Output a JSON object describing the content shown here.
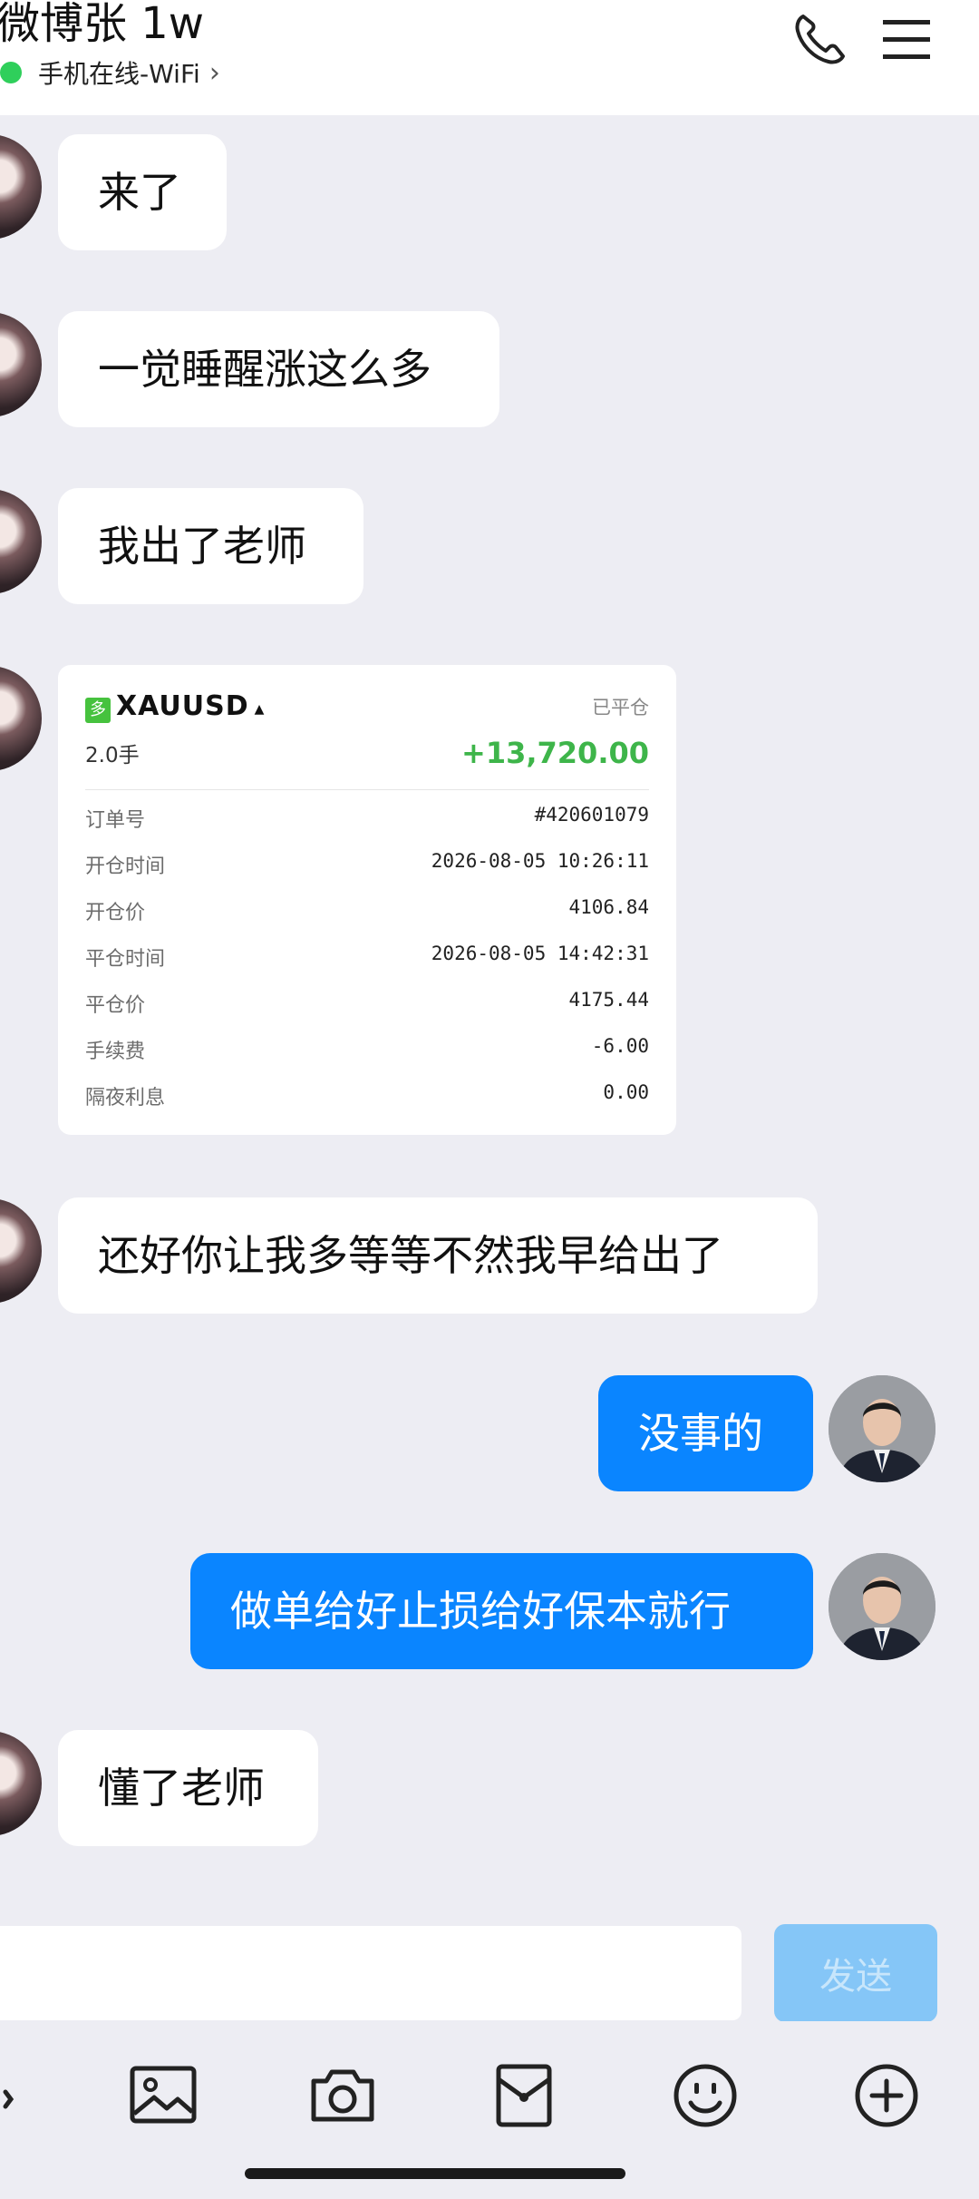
{
  "header": {
    "title": "微博张 1w",
    "status": "手机在线-WiFi",
    "status_chevron": "›",
    "status_color": "#2fcf5b",
    "icons": [
      "phone-icon",
      "menu-icon"
    ]
  },
  "messages": [
    {
      "side": "in",
      "text": "来了"
    },
    {
      "side": "in",
      "text": "一觉睡醒涨这么多"
    },
    {
      "side": "in",
      "text": "我出了老师"
    },
    {
      "side": "in",
      "text": "还好你让我多等等不然我早给出了"
    },
    {
      "side": "out",
      "text": "没事的"
    },
    {
      "side": "out",
      "text": "做单给好止损给好保本就行"
    },
    {
      "side": "in",
      "text": "懂了老师"
    }
  ],
  "trade_card": {
    "badge": "多",
    "symbol": "XAUUSD",
    "status": "已平仓",
    "lots": "2.0手",
    "pnl": "+13,720.00",
    "pnl_color": "#3eb54a",
    "rows": [
      {
        "label": "订单号",
        "value": "#420601079"
      },
      {
        "label": "开仓时间",
        "value": "2026-08-05 10:26:11"
      },
      {
        "label": "开仓价",
        "value": "4106.84"
      },
      {
        "label": "平仓时间",
        "value": "2026-08-05 14:42:31"
      },
      {
        "label": "平仓价",
        "value": "4175.44"
      },
      {
        "label": "手续费",
        "value": "-6.00"
      },
      {
        "label": "隔夜利息",
        "value": "0.00"
      }
    ]
  },
  "composer": {
    "input_value": "",
    "send_label": "发送",
    "send_color": "#85c6f7"
  },
  "toolbar_icons": [
    "voice-icon",
    "image-icon",
    "camera-icon",
    "red-packet-icon",
    "emoji-icon",
    "plus-icon"
  ],
  "colors": {
    "background": "#ededf3",
    "outgoing_bubble": "#0a85ff",
    "incoming_bubble": "#ffffff"
  }
}
